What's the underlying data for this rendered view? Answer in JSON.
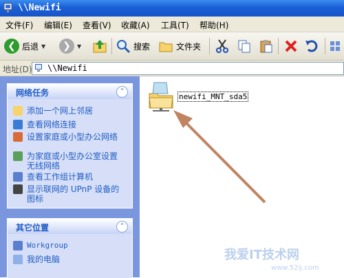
{
  "window": {
    "title": "\\\\Newifi"
  },
  "menu": {
    "items": [
      "文件(F)",
      "编辑(E)",
      "查看(V)",
      "收藏(A)",
      "工具(T)",
      "帮助(H)"
    ]
  },
  "toolbar": {
    "back": "后退",
    "search": "搜索",
    "folders": "文件夹"
  },
  "address": {
    "label": "地址(D)",
    "value": "\\\\Newifi"
  },
  "network_tasks": {
    "title": "网络任务",
    "items": [
      "添加一个网上邻居",
      "查看网络连接",
      "设置家庭或小型办公网络",
      "为家庭或小型办公室设置无线网络",
      "查看工作组计算机",
      "显示联网的 UPnP 设备的图标"
    ]
  },
  "other_places": {
    "title": "其它位置",
    "items": [
      "Workgroup",
      "我的电脑"
    ]
  },
  "content": {
    "folder_name": "newifi_MNT_sda5"
  },
  "watermark": {
    "text": "我爱IT技术网",
    "url": "www.52ij.com"
  }
}
